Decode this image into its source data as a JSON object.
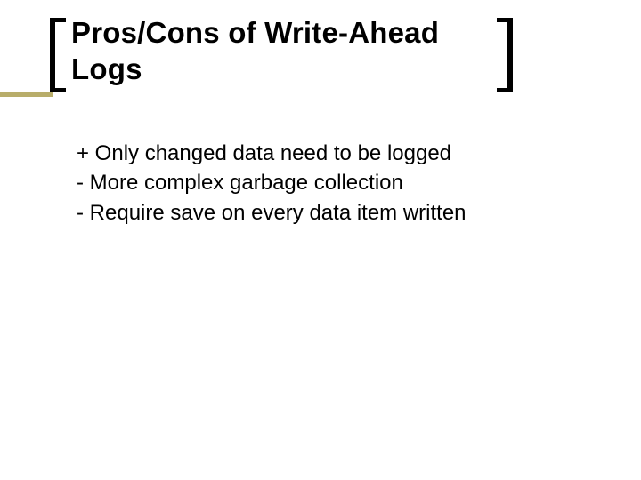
{
  "title": "Pros/Cons of Write-Ahead Logs",
  "items": [
    "+ Only changed data need to be logged",
    "- More complex garbage collection",
    "- Require save on every data item written"
  ],
  "colors": {
    "accent": "#b8ad6a",
    "text": "#000000",
    "background": "#ffffff"
  }
}
